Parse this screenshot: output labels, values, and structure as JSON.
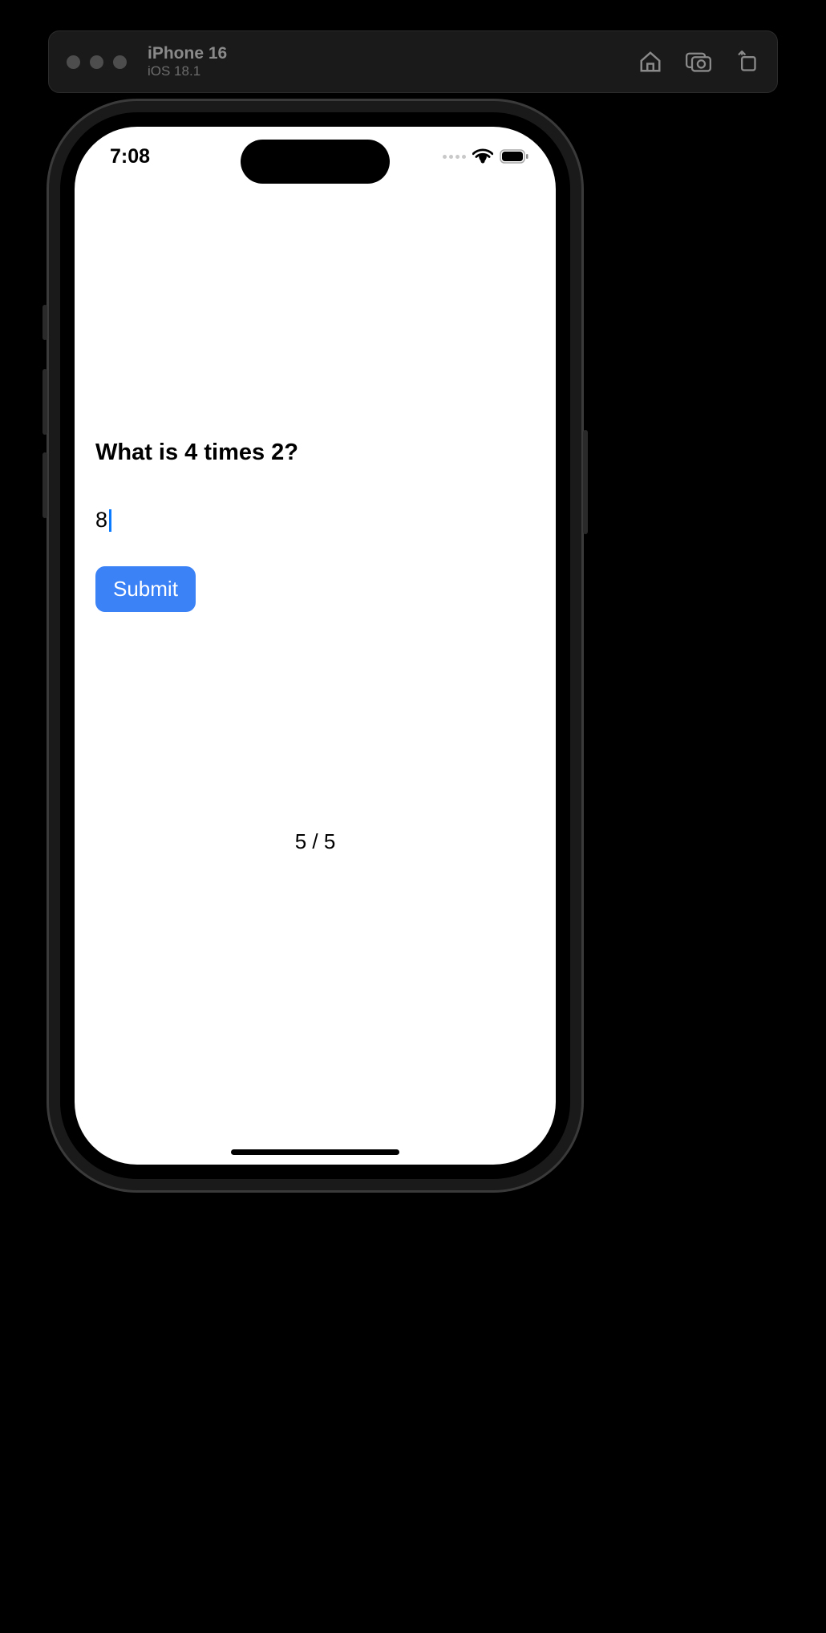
{
  "simulator": {
    "device_name": "iPhone 16",
    "os_version": "iOS 18.1"
  },
  "status_bar": {
    "time": "7:08"
  },
  "quiz": {
    "question": "What is 4 times 2?",
    "answer_value": "8",
    "answer_placeholder": "",
    "submit_label": "Submit",
    "progress": "5 / 5"
  },
  "icons": {
    "home": "home-icon",
    "screenshot": "screenshot-icon",
    "rotate": "rotate-icon",
    "wifi": "wifi-icon",
    "battery": "battery-icon",
    "cellular": "cellular-dots-icon"
  }
}
